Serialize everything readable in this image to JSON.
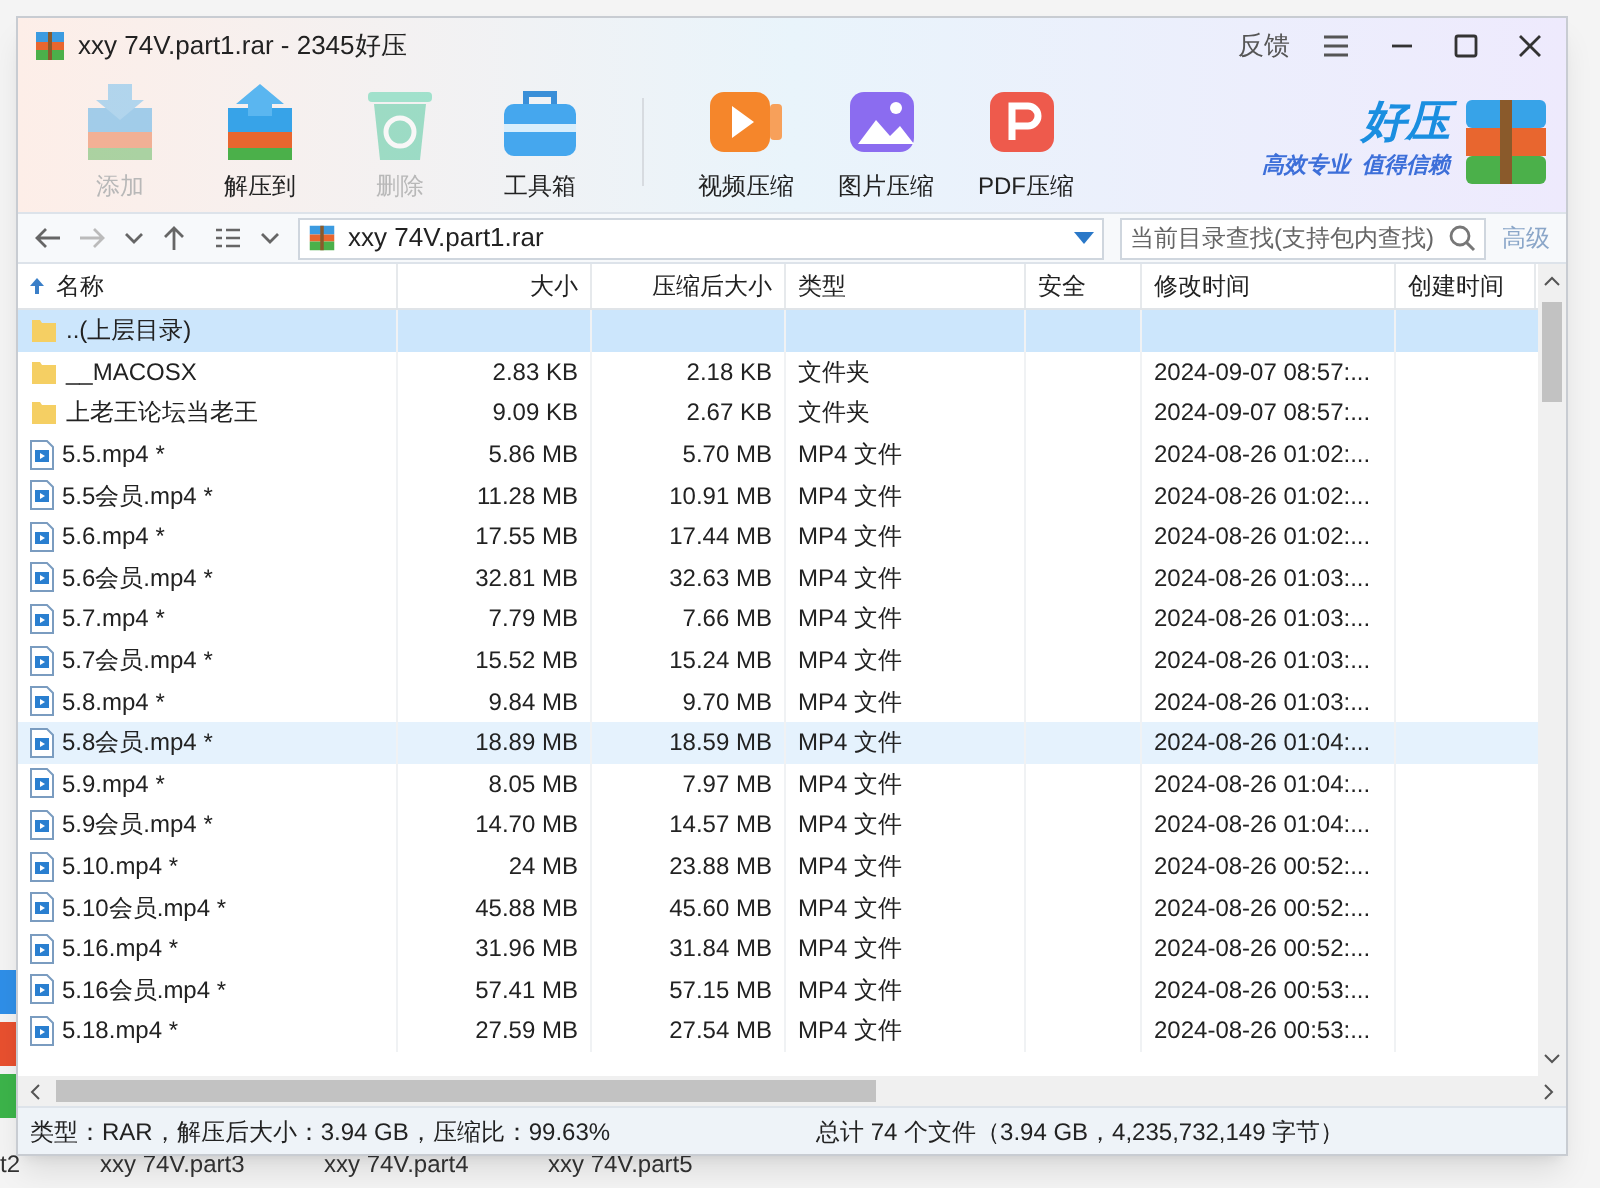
{
  "window": {
    "title": "xxy 74V.part1.rar - 2345好压",
    "feedback": "反馈"
  },
  "toolbar": [
    {
      "label": "添加",
      "kind": "add",
      "disabled": true
    },
    {
      "label": "解压到",
      "kind": "extract",
      "disabled": false
    },
    {
      "label": "删除",
      "kind": "delete",
      "disabled": true
    },
    {
      "label": "工具箱",
      "kind": "toolbox",
      "disabled": false
    },
    {
      "label": "视频压缩",
      "kind": "video",
      "disabled": false
    },
    {
      "label": "图片压缩",
      "kind": "image",
      "disabled": false
    },
    {
      "label": "PDF压缩",
      "kind": "pdf",
      "disabled": false
    }
  ],
  "brand": {
    "name": "好压",
    "slogan_1": "高效专业",
    "slogan_2": "值得信赖"
  },
  "path": "xxy 74V.part1.rar",
  "search": {
    "placeholder": "当前目录查找(支持包内查找)",
    "advanced": "高级"
  },
  "columns": [
    "名称",
    "大小",
    "压缩后大小",
    "类型",
    "安全",
    "修改时间",
    "创建时间"
  ],
  "rows": [
    {
      "kind": "parent",
      "name": "..(上层目录)",
      "size": "",
      "packed": "",
      "type": "",
      "modified": "",
      "selected": true,
      "hovered": false
    },
    {
      "kind": "folder",
      "name": "__MACOSX",
      "size": "2.83 KB",
      "packed": "2.18 KB",
      "type": "文件夹",
      "modified": "2024-09-07 08:57:...",
      "selected": false,
      "hovered": false
    },
    {
      "kind": "folder",
      "name": "上老王论坛当老王",
      "size": "9.09 KB",
      "packed": "2.67 KB",
      "type": "文件夹",
      "modified": "2024-09-07 08:57:...",
      "selected": false,
      "hovered": false
    },
    {
      "kind": "video",
      "name": "5.5.mp4 *",
      "size": "5.86 MB",
      "packed": "5.70 MB",
      "type": "MP4 文件",
      "modified": "2024-08-26 01:02:...",
      "selected": false,
      "hovered": false
    },
    {
      "kind": "video",
      "name": "5.5会员.mp4 *",
      "size": "11.28 MB",
      "packed": "10.91 MB",
      "type": "MP4 文件",
      "modified": "2024-08-26 01:02:...",
      "selected": false,
      "hovered": false
    },
    {
      "kind": "video",
      "name": "5.6.mp4 *",
      "size": "17.55 MB",
      "packed": "17.44 MB",
      "type": "MP4 文件",
      "modified": "2024-08-26 01:02:...",
      "selected": false,
      "hovered": false
    },
    {
      "kind": "video",
      "name": "5.6会员.mp4 *",
      "size": "32.81 MB",
      "packed": "32.63 MB",
      "type": "MP4 文件",
      "modified": "2024-08-26 01:03:...",
      "selected": false,
      "hovered": false
    },
    {
      "kind": "video",
      "name": "5.7.mp4 *",
      "size": "7.79 MB",
      "packed": "7.66 MB",
      "type": "MP4 文件",
      "modified": "2024-08-26 01:03:...",
      "selected": false,
      "hovered": false
    },
    {
      "kind": "video",
      "name": "5.7会员.mp4 *",
      "size": "15.52 MB",
      "packed": "15.24 MB",
      "type": "MP4 文件",
      "modified": "2024-08-26 01:03:...",
      "selected": false,
      "hovered": false
    },
    {
      "kind": "video",
      "name": "5.8.mp4 *",
      "size": "9.84 MB",
      "packed": "9.70 MB",
      "type": "MP4 文件",
      "modified": "2024-08-26 01:03:...",
      "selected": false,
      "hovered": false
    },
    {
      "kind": "video",
      "name": "5.8会员.mp4 *",
      "size": "18.89 MB",
      "packed": "18.59 MB",
      "type": "MP4 文件",
      "modified": "2024-08-26 01:04:...",
      "selected": false,
      "hovered": true
    },
    {
      "kind": "video",
      "name": "5.9.mp4 *",
      "size": "8.05 MB",
      "packed": "7.97 MB",
      "type": "MP4 文件",
      "modified": "2024-08-26 01:04:...",
      "selected": false,
      "hovered": false
    },
    {
      "kind": "video",
      "name": "5.9会员.mp4 *",
      "size": "14.70 MB",
      "packed": "14.57 MB",
      "type": "MP4 文件",
      "modified": "2024-08-26 01:04:...",
      "selected": false,
      "hovered": false
    },
    {
      "kind": "video",
      "name": "5.10.mp4 *",
      "size": "24 MB",
      "packed": "23.88 MB",
      "type": "MP4 文件",
      "modified": "2024-08-26 00:52:...",
      "selected": false,
      "hovered": false
    },
    {
      "kind": "video",
      "name": "5.10会员.mp4 *",
      "size": "45.88 MB",
      "packed": "45.60 MB",
      "type": "MP4 文件",
      "modified": "2024-08-26 00:52:...",
      "selected": false,
      "hovered": false
    },
    {
      "kind": "video",
      "name": "5.16.mp4 *",
      "size": "31.96 MB",
      "packed": "31.84 MB",
      "type": "MP4 文件",
      "modified": "2024-08-26 00:52:...",
      "selected": false,
      "hovered": false
    },
    {
      "kind": "video",
      "name": "5.16会员.mp4 *",
      "size": "57.41 MB",
      "packed": "57.15 MB",
      "type": "MP4 文件",
      "modified": "2024-08-26 00:53:...",
      "selected": false,
      "hovered": false
    },
    {
      "kind": "video",
      "name": "5.18.mp4 *",
      "size": "27.59 MB",
      "packed": "27.54 MB",
      "type": "MP4 文件",
      "modified": "2024-08-26 00:53:...",
      "selected": false,
      "hovered": false
    }
  ],
  "status_bar": {
    "left": "类型：RAR，解压后大小：3.94 GB，压缩比：99.63%",
    "right": "总计 74 个文件（3.94 GB，4,235,732,149 字节）"
  },
  "background_files": [
    "t2",
    "xxy 74V.part3",
    "xxy 74V.part4",
    "xxy 74V.part5"
  ]
}
